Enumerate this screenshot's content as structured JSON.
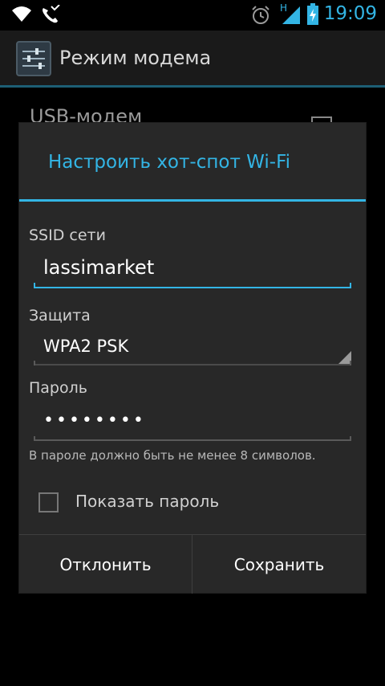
{
  "status_bar": {
    "time": "19:09",
    "network_type": "H",
    "icons": [
      "wifi-icon",
      "missed-call-icon",
      "alarm-icon",
      "signal-icon",
      "battery-charging-icon"
    ]
  },
  "action_bar": {
    "title": "Режим модема",
    "icon": "settings-icon"
  },
  "background": {
    "item_title": "USB-модем"
  },
  "dialog": {
    "title": "Настроить хот-спот Wi-Fi",
    "ssid_label": "SSID сети",
    "ssid_value": "lassimarket",
    "security_label": "Защита",
    "security_value": "WPA2 PSK",
    "password_label": "Пароль",
    "password_value": "••••••••",
    "hint": "В пароле должно быть не менее 8 символов.",
    "show_password_label": "Показать пароль",
    "show_password_checked": false,
    "cancel_label": "Отклонить",
    "save_label": "Сохранить"
  },
  "colors": {
    "accent": "#33b5e5",
    "dialog_bg": "#282828",
    "divider": "#3e3e3e"
  }
}
